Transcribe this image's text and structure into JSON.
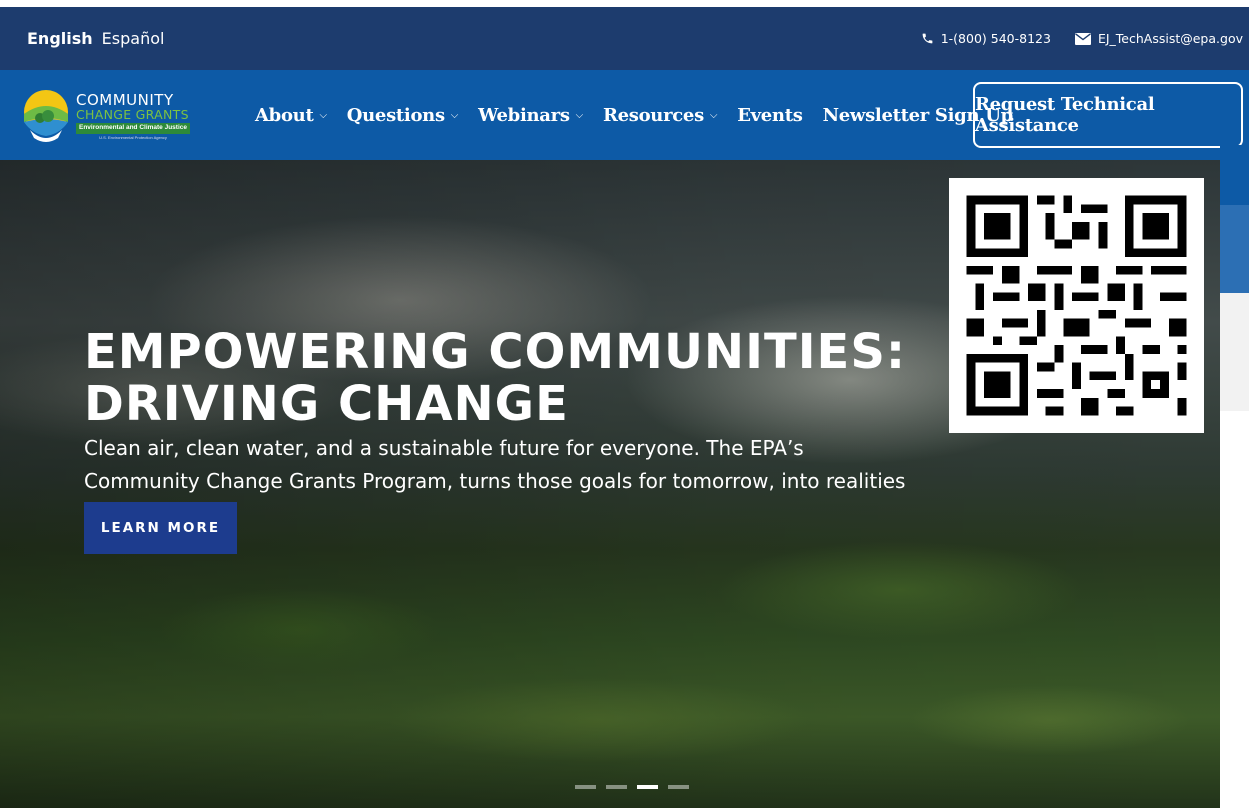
{
  "topbar": {
    "lang_english": "English",
    "lang_spanish": "Español",
    "phone": "1-(800) 540-8123",
    "email": "EJ_TechAssist@epa.gov",
    "phone_icon": "phone-icon",
    "email_icon": "envelope-icon"
  },
  "logo": {
    "line1": "COMMUNITY",
    "line2": "CHANGE GRANTS",
    "line3": "Environmental and Climate Justice",
    "line4": "U.S. Environmental Protection Agency"
  },
  "nav": {
    "about": "About",
    "questions": "Questions",
    "webinars": "Webinars",
    "resources": "Resources",
    "events": "Events",
    "newsletter": "Newsletter Sign Up",
    "chevron": "⌵",
    "cta": "Request Technical Assistance"
  },
  "hero": {
    "title_line1": "EMPOWERING COMMUNITIES:",
    "title_line2": "DRIVING CHANGE",
    "subtitle": "Clean air, clean water, and a sustainable future for everyone. The EPA’s Community Change Grants Program, turns those goals for tomorrow, into realities for today.",
    "button": "LEARN MORE",
    "slides_total": 4,
    "active_slide": 3
  },
  "colors": {
    "topbar": "#1d3c6e",
    "navbar": "#0d5aa6",
    "button": "#1d3c8e"
  }
}
